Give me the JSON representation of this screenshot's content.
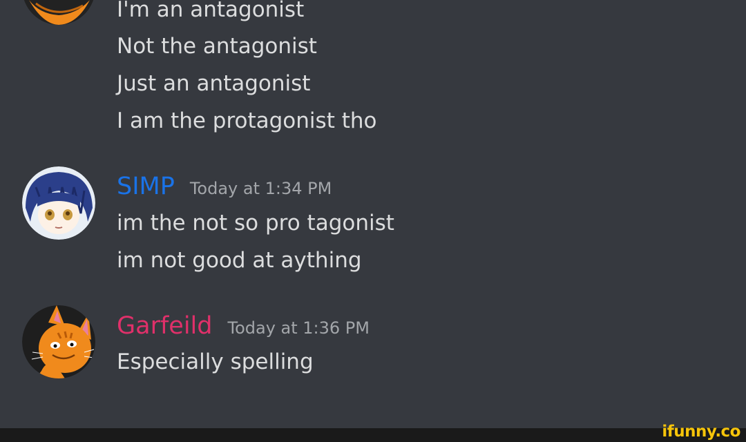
{
  "messages": [
    {
      "lines": [
        "I'm an antagonist",
        "Not the antagonist",
        "Just an antagonist",
        "I am the protagonist tho"
      ]
    },
    {
      "username": "SIMP",
      "username_color": "#1a73e8",
      "timestamp": "Today at 1:34 PM",
      "avatar": "anime-girl-avatar",
      "lines": [
        "im the not so pro tagonist",
        "im not good at aything"
      ]
    },
    {
      "username": "Garfeild",
      "username_color": "#e0306a",
      "timestamp": "Today at 1:36 PM",
      "avatar": "orange-cat-avatar",
      "lines": [
        "Especially spelling"
      ]
    }
  ],
  "watermark": "ifunny.co"
}
